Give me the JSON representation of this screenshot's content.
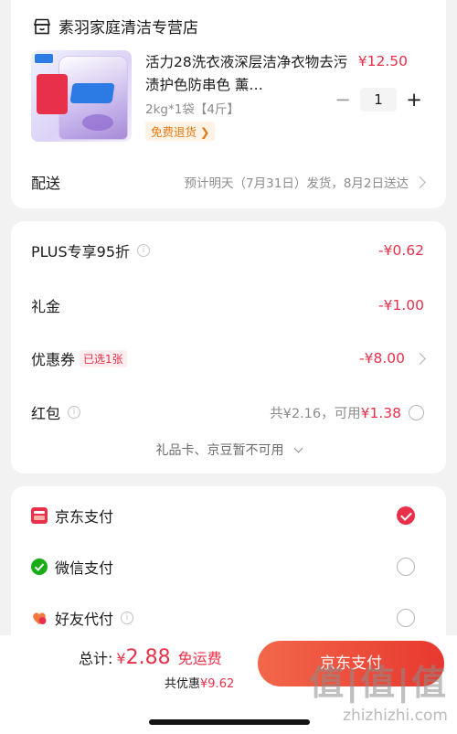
{
  "shop": {
    "name": "素羽家庭清洁专营店",
    "product": {
      "title": "活力28洗衣液深层洁净衣物去污渍护色防串色 薰…",
      "spec": "2kg*1袋【4斤】",
      "return_badge": "免费退货 ❯",
      "price": "¥12.50",
      "quantity": "1",
      "minus": "−",
      "plus": "+"
    },
    "shipping": {
      "label": "配送",
      "value": "预计明天（7月31日）发货，8月2日送达"
    }
  },
  "discounts": {
    "plus": {
      "label": "PLUS专享95折",
      "info": "i",
      "amount": "-¥0.62"
    },
    "gift": {
      "label": "礼金",
      "amount": "-¥1.00"
    },
    "coupon": {
      "label": "优惠券",
      "chip": "已选1张",
      "amount": "-¥8.00"
    },
    "redpack": {
      "label": "红包",
      "info": "i",
      "total": "共¥2.16，可用",
      "usable": "¥1.38"
    },
    "unavailable": "礼品卡、京豆暂不可用"
  },
  "payment": {
    "methods": [
      {
        "label": "京东支付",
        "selected": true,
        "icon": "jd-pay-icon"
      },
      {
        "label": "微信支付",
        "selected": false,
        "icon": "wechat-pay-icon"
      },
      {
        "label": "好友代付",
        "selected": false,
        "icon": "friend-pay-icon",
        "info": "i"
      }
    ]
  },
  "footer": {
    "total_label": "总计:",
    "currency": "¥",
    "total": "2.88",
    "free_shipping": "免运费",
    "saved_label": "共优惠",
    "saved": "¥9.62",
    "pay_button": "京东支付"
  },
  "watermark": {
    "logo": "值|值|值",
    "url": "zhizhizhi.com"
  },
  "colors": {
    "accent": "#e8304a",
    "button_start": "#f2674a",
    "button_end": "#e8382f",
    "wechat": "#1aad19"
  }
}
